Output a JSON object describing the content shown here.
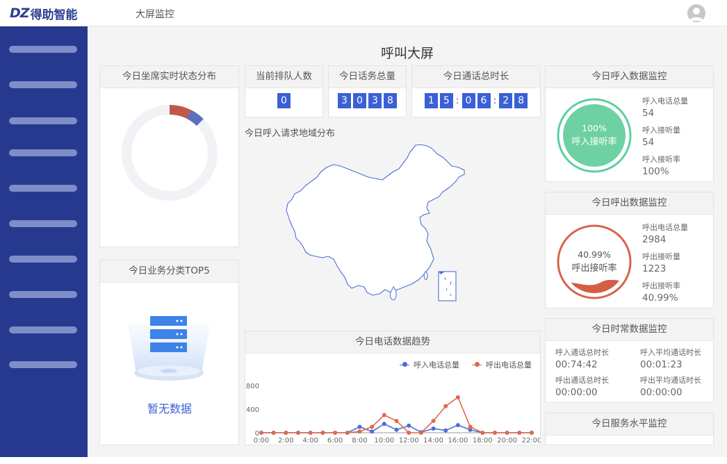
{
  "brand": {
    "mark": "DZ",
    "name": "得助智能"
  },
  "nav": {
    "title": "大屏监控"
  },
  "page": {
    "title": "呼叫大屏"
  },
  "panels": {
    "seat_status": {
      "title": "今日坐席实时状态分布"
    },
    "top5": {
      "title": "今日业务分类TOP5",
      "empty_text": "暂无数据"
    },
    "queue": {
      "title": "当前排队人数",
      "digits": [
        "0"
      ]
    },
    "total_calls": {
      "title": "今日话务总量",
      "digits": [
        "3",
        "0",
        "3",
        "8"
      ]
    },
    "call_duration": {
      "title": "今日通话总时长",
      "digits": [
        "1",
        "5",
        ":",
        "0",
        "6",
        ":",
        "2",
        "8"
      ]
    },
    "region": {
      "title": "今日呼入请求地域分布"
    },
    "trend": {
      "title": "今日电话数据趋势"
    },
    "inbound": {
      "title": "今日呼入数据监控",
      "ring_pct": "100%",
      "ring_label": "呼入接听率",
      "ring_value": 1.0,
      "stats": [
        {
          "label": "呼入电话总量",
          "value": "54"
        },
        {
          "label": "呼入接听量",
          "value": "54"
        },
        {
          "label": "呼入接听率",
          "value": "100%"
        }
      ]
    },
    "outbound": {
      "title": "今日呼出数据监控",
      "ring_pct": "40.99%",
      "ring_label": "呼出接听率",
      "ring_value": 0.4099,
      "stats": [
        {
          "label": "呼出电话总量",
          "value": "2984"
        },
        {
          "label": "呼出接听量",
          "value": "1223"
        },
        {
          "label": "呼出接听率",
          "value": "40.99%"
        }
      ]
    },
    "duration": {
      "title": "今日时常数据监控",
      "items": [
        {
          "label": "呼入通话总时长",
          "value": "00:74:42"
        },
        {
          "label": "呼入平均通话时长",
          "value": "00:01:23"
        },
        {
          "label": "呼出通话总时长",
          "value": "00:00:00"
        },
        {
          "label": "呼出平均通话时长",
          "value": "00:00:00"
        }
      ]
    },
    "service": {
      "title": "今日服务水平监控"
    }
  },
  "colors": {
    "accent": "#3b60d6",
    "sidebar": "#27398f",
    "inbound": "#4b6ed6",
    "outbound": "#e0694d",
    "green": "#5ccf9f"
  },
  "donut": {
    "segments": [
      {
        "color": "#c0584a",
        "value": 0.075
      },
      {
        "color": "#5a6fbf",
        "value": 0.05
      }
    ]
  },
  "chart_data": {
    "type": "line",
    "title": "今日电话数据趋势",
    "x": [
      "0:00",
      "1:00",
      "2:00",
      "3:00",
      "4:00",
      "5:00",
      "6:00",
      "7:00",
      "8:00",
      "9:00",
      "10:00",
      "11:00",
      "12:00",
      "13:00",
      "14:00",
      "15:00",
      "16:00",
      "17:00",
      "18:00",
      "19:00",
      "20:00",
      "21:00",
      "22:00"
    ],
    "x_ticks": [
      "0:00",
      "2:00",
      "4:00",
      "6:00",
      "8:00",
      "10:00",
      "12:00",
      "14:00",
      "16:00",
      "18:00",
      "20:00",
      "22:00"
    ],
    "y_ticks": [
      "0",
      "400",
      "800"
    ],
    "ylim": [
      0,
      800
    ],
    "grid": false,
    "legend": "top-right",
    "series": [
      {
        "name": "呼入电话总量",
        "color": "#4b6ed6",
        "values": [
          0,
          0,
          0,
          0,
          0,
          0,
          0,
          0,
          100,
          20,
          150,
          50,
          120,
          10,
          70,
          40,
          130,
          50,
          0,
          0,
          0,
          0,
          0
        ]
      },
      {
        "name": "呼出电话总量",
        "color": "#e0694d",
        "values": [
          0,
          0,
          0,
          0,
          0,
          0,
          0,
          0,
          20,
          100,
          300,
          200,
          0,
          0,
          200,
          450,
          600,
          100,
          0,
          0,
          0,
          0,
          0
        ]
      }
    ]
  }
}
